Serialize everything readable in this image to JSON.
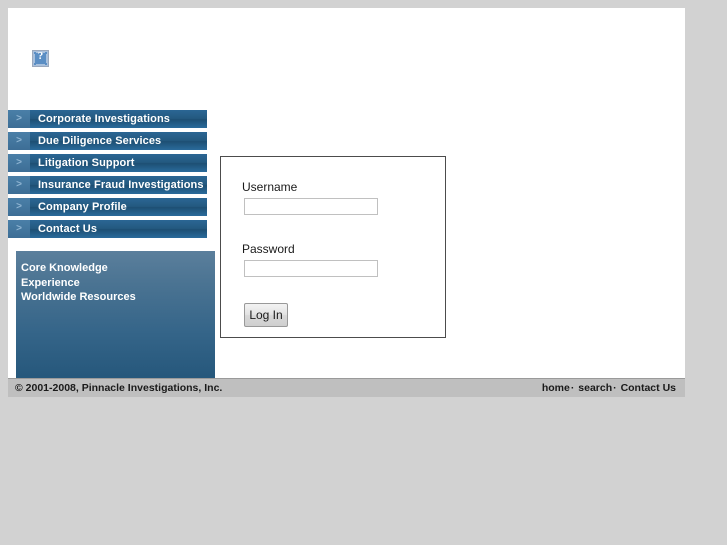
{
  "site": {
    "logo_icon": "broken-image-icon",
    "logo_alt": "?"
  },
  "nav": {
    "arrow_icon": "chevron-right-icon",
    "items": [
      {
        "label": "Corporate Investigations"
      },
      {
        "label": "Due Diligence Services"
      },
      {
        "label": "Litigation Support"
      },
      {
        "label": "Insurance Fraud Investigations"
      },
      {
        "label": "Company Profile"
      },
      {
        "label": "Contact Us"
      }
    ]
  },
  "side_panel": {
    "links": [
      {
        "label": "Core Knowledge"
      },
      {
        "label": "Experience"
      },
      {
        "label": "Worldwide Resources"
      }
    ]
  },
  "login": {
    "username_label": "Username",
    "username_value": "",
    "username_placeholder": "",
    "password_label": "Password",
    "password_value": "",
    "password_placeholder": "",
    "submit_label": "Log In"
  },
  "footer": {
    "copyright": "© 2001-2008, Pinnacle Investigations, Inc.",
    "links": [
      {
        "label": "home"
      },
      {
        "label": "search"
      },
      {
        "label": "Contact Us"
      }
    ],
    "separator": "·"
  },
  "colors": {
    "page_background": "#d2d2d2",
    "content_background": "#ffffff",
    "nav_blue": "#255f8c",
    "nav_arrow_blue": "#43769f",
    "panel_top": "#5b7f9c",
    "panel_bottom": "#235579",
    "footer_gray": "#bfbfbf",
    "box_border": "#4c4c4c"
  }
}
